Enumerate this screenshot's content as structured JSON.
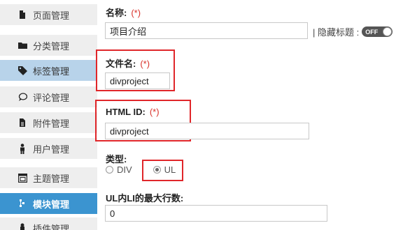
{
  "sidebar": {
    "items": [
      {
        "label": "页面管理",
        "icon": "file-icon"
      },
      {
        "label": "分类管理",
        "icon": "folder-icon"
      },
      {
        "label": "标签管理",
        "icon": "tag-icon"
      },
      {
        "label": "评论管理",
        "icon": "comment-icon"
      },
      {
        "label": "附件管理",
        "icon": "attachment-icon"
      },
      {
        "label": "用户管理",
        "icon": "user-icon"
      },
      {
        "label": "主题管理",
        "icon": "theme-icon"
      },
      {
        "label": "模块管理",
        "icon": "module-icon"
      },
      {
        "label": "插件管理",
        "icon": "plugin-icon"
      }
    ]
  },
  "form": {
    "name_label": "名称:",
    "name_required": "(*)",
    "name_value": "项目介绍",
    "hide_title_label": "| 隐藏标题 :",
    "toggle_text": "OFF",
    "filename_label": "文件名:",
    "filename_required": "(*)",
    "filename_value": "divproject",
    "htmlid_label": "HTML ID:",
    "htmlid_required": "(*)",
    "htmlid_value": "divproject",
    "type_label": "类型:",
    "type_options": [
      "DIV",
      "UL"
    ],
    "type_selected": "UL",
    "maxrows_label": "UL内LI的最大行数:",
    "maxrows_value": "0"
  }
}
